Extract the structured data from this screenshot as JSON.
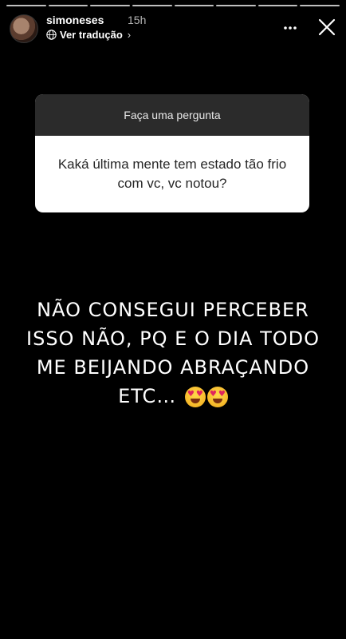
{
  "progress_segments": 8,
  "header": {
    "username": "simoneses",
    "time": "15h",
    "translate_label": "Ver tradução",
    "translate_chevron": "›",
    "more_icon": "more-horizontal-icon",
    "close_icon": "close-icon"
  },
  "question_card": {
    "title": "Faça uma pergunta",
    "question": "Kaká última mente tem estado tão frio com vc, vc notou?"
  },
  "answer": {
    "lines": [
      "NÃO CONSEGUI PERCEBER",
      "ISSO NÃO, PQ E O DIA TODO",
      "ME BEIJANDO ABRAÇANDO",
      "ETC…"
    ]
  },
  "colors": {
    "background": "#000000",
    "card_header": "#2b2b2b",
    "card_body": "#ffffff",
    "text_primary": "#ffffff"
  }
}
